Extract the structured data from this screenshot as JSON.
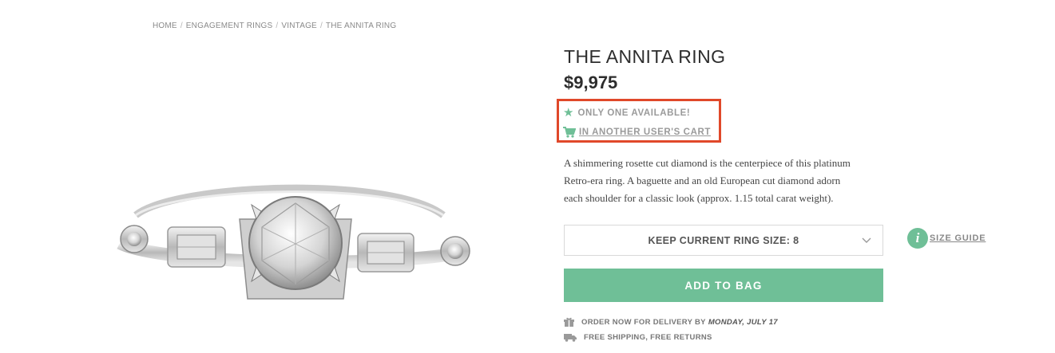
{
  "breadcrumb": [
    "HOME",
    "ENGAGEMENT RINGS",
    "VINTAGE",
    "THE ANNITA RING"
  ],
  "breadcrumb_separator": "/",
  "product": {
    "title": "THE ANNITA RING",
    "price": "$9,975",
    "availability": "ONLY ONE AVAILABLE!",
    "cart_status": "IN ANOTHER USER'S CART",
    "description": "A shimmering rosette cut diamond is the centerpiece of this platinum Retro-era ring. A baguette and an old European cut diamond adorn each shoulder for a classic look (approx. 1.15 total carat weight)."
  },
  "size_select": {
    "label": "KEEP CURRENT RING SIZE: 8"
  },
  "size_guide": {
    "label": "SIZE GUIDE",
    "icon_glyph": "i"
  },
  "add_to_bag": "ADD TO BAG",
  "shipping": {
    "order_prefix": "ORDER NOW FOR DELIVERY BY",
    "delivery_date": "MONDAY, JULY 17",
    "free_shipping": "FREE SHIPPING, FREE RETURNS"
  },
  "icons": {
    "availability": "star-icon",
    "cart": "cart-icon",
    "select": "chevron-down-icon",
    "info": "info-icon",
    "gift": "gift-icon",
    "truck": "truck-icon"
  },
  "colors": {
    "accent": "#6fbf97",
    "highlight_border": "#e0482a",
    "text_dark": "#2d2d2d",
    "text_muted": "#9a9a9a"
  }
}
